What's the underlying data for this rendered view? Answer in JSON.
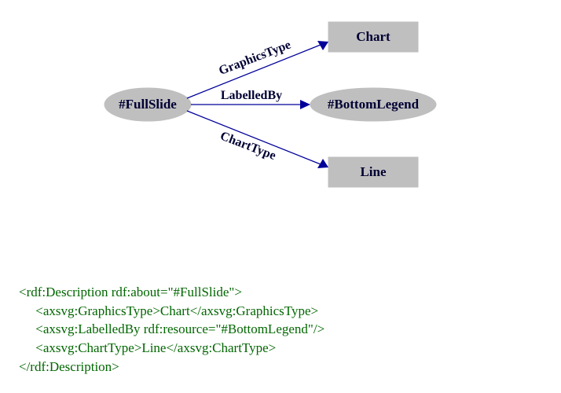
{
  "diagram": {
    "root": {
      "label": "#FullSlide"
    },
    "targets": {
      "chart": "Chart",
      "legend": "#BottomLegend",
      "line": "Line"
    },
    "edges": {
      "graphicsType": "GraphicsType",
      "labelledBy": "LabelledBy",
      "chartType": "ChartType"
    }
  },
  "code": {
    "l1": "<rdf:Description rdf:about=\"#FullSlide\">",
    "l2": "     <axsvg:GraphicsType>Chart</axsvg:GraphicsType>",
    "l3": "     <axsvg:LabelledBy rdf:resource=\"#BottomLegend\"/>",
    "l4": "     <axsvg:ChartType>Line</axsvg:ChartType>",
    "l5": "</rdf:Description>"
  }
}
